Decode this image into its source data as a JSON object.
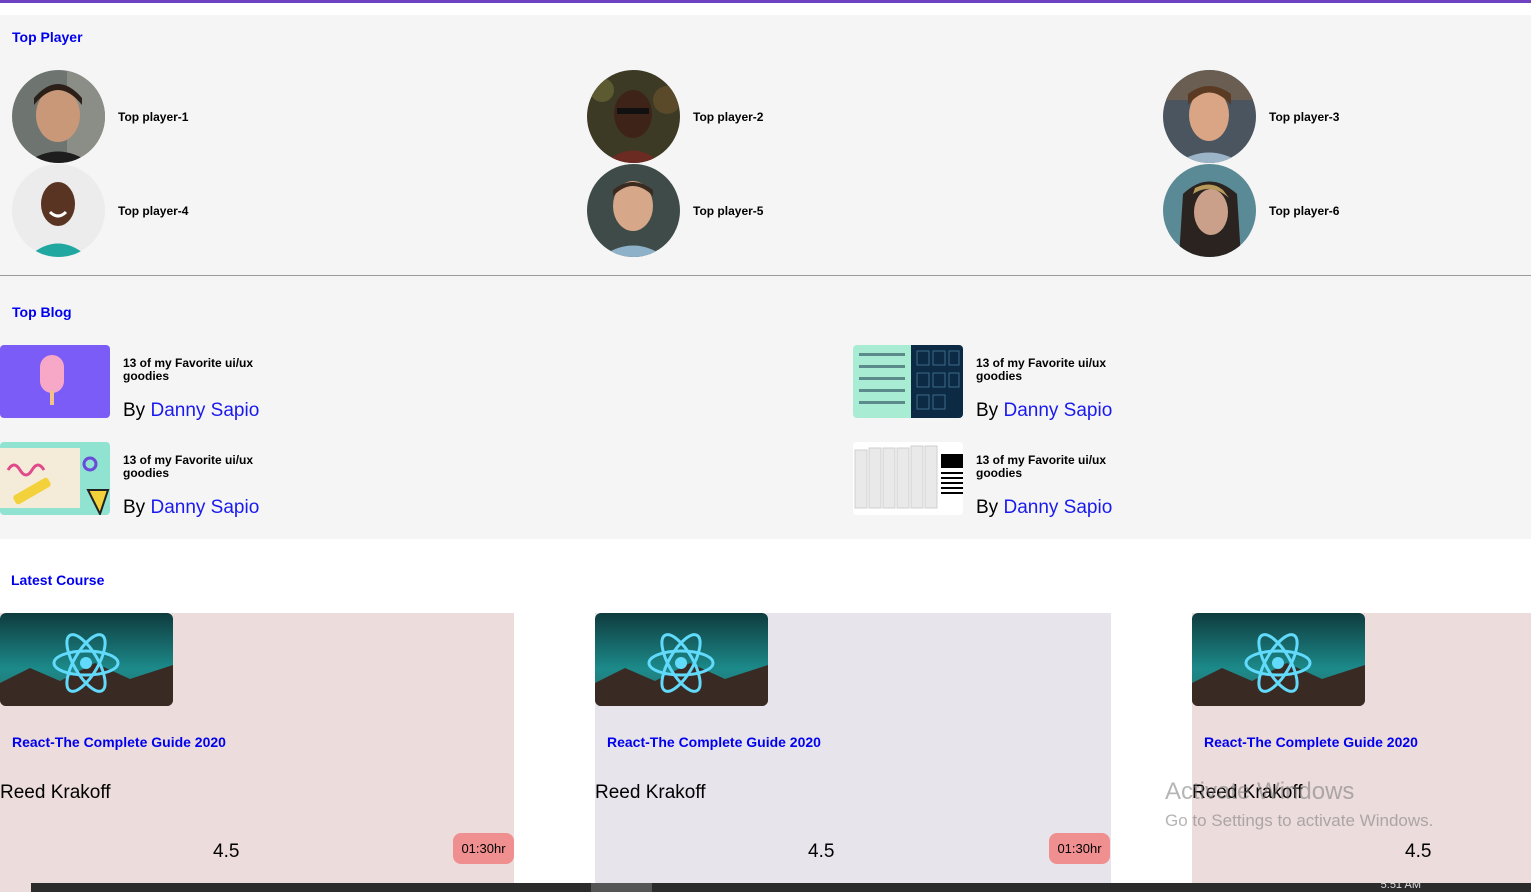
{
  "top_player": {
    "title": "Top Player",
    "players": [
      {
        "label": "Top player-1"
      },
      {
        "label": "Top player-2"
      },
      {
        "label": "Top player-3"
      },
      {
        "label": "Top player-4"
      },
      {
        "label": "Top player-5"
      },
      {
        "label": "Top player-6"
      }
    ]
  },
  "top_blog": {
    "title": "Top Blog",
    "posts": [
      {
        "title": "13 of my Favorite ui/ux goodies",
        "by": "By",
        "author": "Danny Sapio"
      },
      {
        "title": "13 of my Favorite ui/ux goodies",
        "by": "By",
        "author": "Danny Sapio"
      },
      {
        "title": "13 of my Favorite ui/ux goodies",
        "by": "By",
        "author": "Danny Sapio"
      },
      {
        "title": "13 of my Favorite ui/ux goodies",
        "by": "By",
        "author": "Danny Sapio"
      }
    ]
  },
  "latest_course": {
    "title": "Latest Course",
    "courses": [
      {
        "title": "React-The Complete Guide 2020",
        "author": "Reed Krakoff",
        "rating": "4.5",
        "duration": "01:30hr",
        "bg": "#ecdcdc"
      },
      {
        "title": "React-The Complete Guide 2020",
        "author": "Reed Krakoff",
        "rating": "4.5",
        "duration": "01:30hr",
        "bg": "#e8e4ec"
      },
      {
        "title": "React-The Complete Guide 2020",
        "author": "Reed Krakoff",
        "rating": "4.5",
        "duration": "",
        "bg": "#ecdcdc"
      }
    ]
  },
  "watermark": {
    "title": "Activate Windows",
    "subtitle": "Go to Settings to activate Windows."
  },
  "taskbar": {
    "clock": "5:51 AM"
  },
  "colors": {
    "accent": "#6f42c1",
    "link": "#0000ee",
    "duration_badge": "#f08f8f"
  }
}
